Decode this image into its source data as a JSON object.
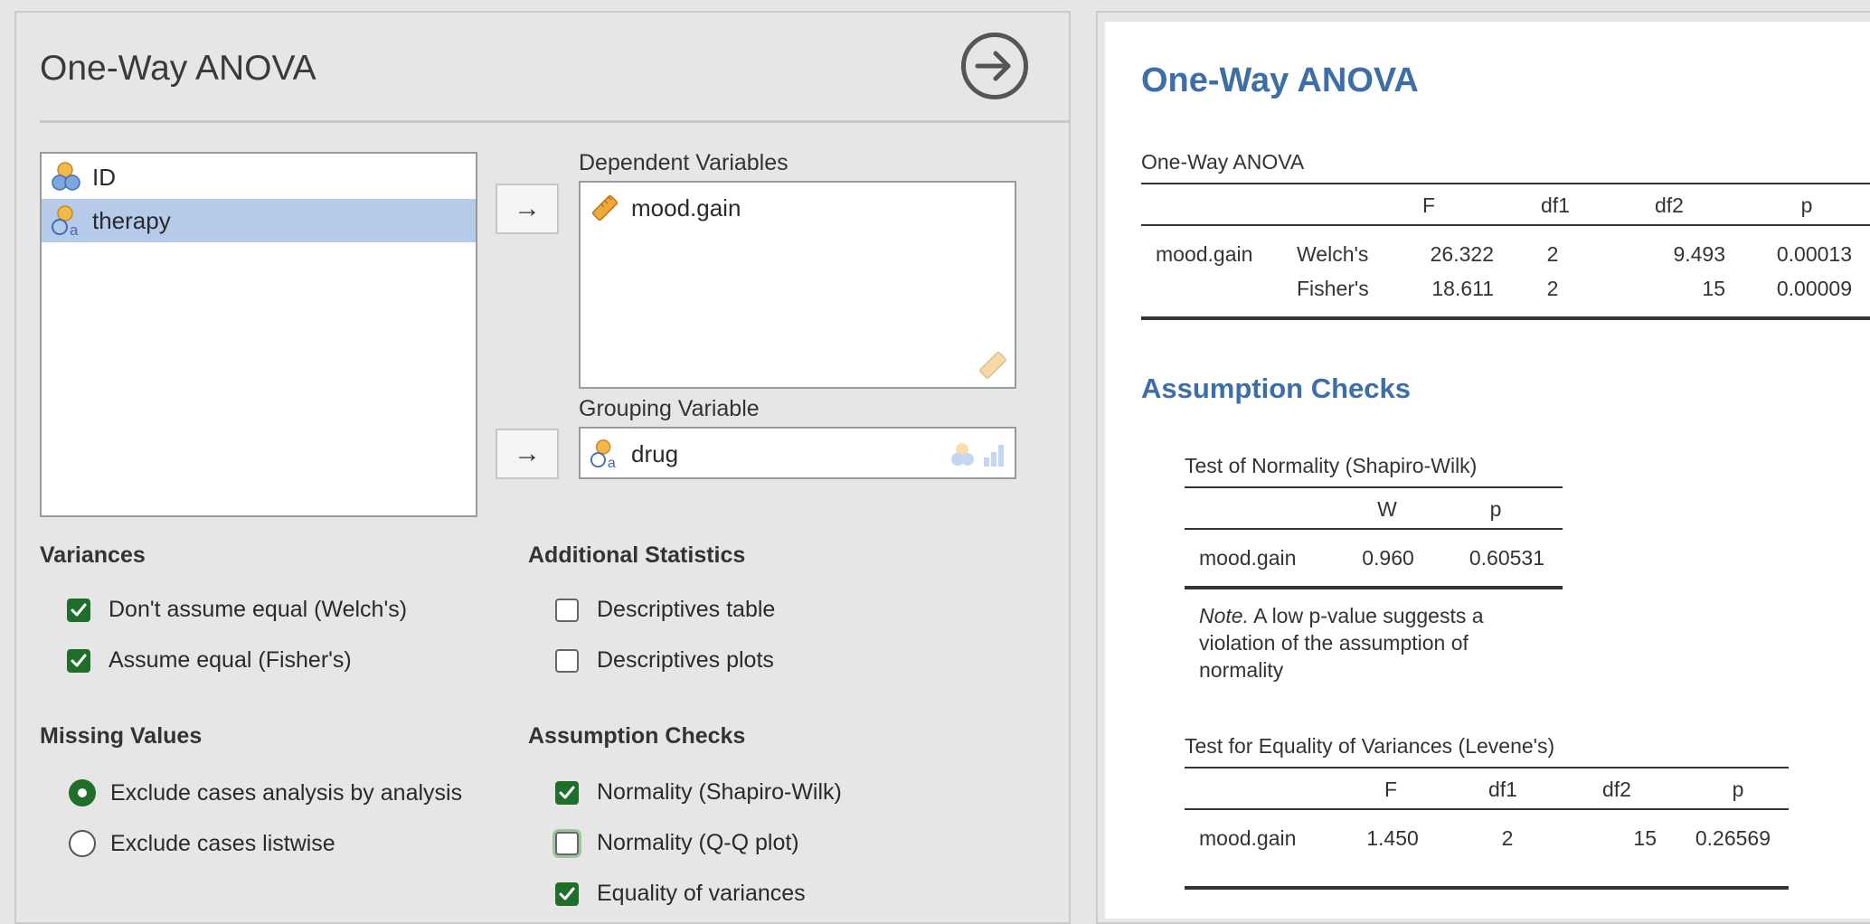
{
  "options": {
    "title": "One-Way ANOVA",
    "variables": [
      {
        "name": "ID",
        "type": "nominal-numeric",
        "selected": false
      },
      {
        "name": "therapy",
        "type": "nominal-text",
        "selected": true
      }
    ],
    "dependent_label": "Dependent Variables",
    "dependent_items": [
      "mood.gain"
    ],
    "grouping_label": "Grouping Variable",
    "grouping_item": "drug",
    "move_arrow": "→",
    "variances": {
      "heading": "Variances",
      "items": [
        {
          "label": "Don't assume equal (Welch's)",
          "checked": true
        },
        {
          "label": "Assume equal (Fisher's)",
          "checked": true
        }
      ]
    },
    "additional": {
      "heading": "Additional Statistics",
      "items": [
        {
          "label": "Descriptives table",
          "checked": false
        },
        {
          "label": "Descriptives plots",
          "checked": false
        }
      ]
    },
    "missing": {
      "heading": "Missing Values",
      "items": [
        {
          "label": "Exclude cases analysis by analysis",
          "selected": true
        },
        {
          "label": "Exclude cases listwise",
          "selected": false
        }
      ]
    },
    "assumptions": {
      "heading": "Assumption Checks",
      "items": [
        {
          "label": "Normality (Shapiro-Wilk)",
          "checked": true
        },
        {
          "label": "Normality (Q-Q plot)",
          "checked": false
        },
        {
          "label": "Equality of variances",
          "checked": true
        }
      ]
    }
  },
  "results": {
    "title": "One-Way ANOVA",
    "anova_table": {
      "title": "One-Way ANOVA",
      "headers": [
        "",
        "",
        "F",
        "df1",
        "df2",
        "p"
      ],
      "rows": [
        [
          "mood.gain",
          "Welch's",
          "26.322",
          "2",
          "9.493",
          "0.00013"
        ],
        [
          "",
          "Fisher's",
          "18.611",
          "2",
          "15",
          "0.00009"
        ]
      ]
    },
    "assumption_title": "Assumption Checks",
    "normality_table": {
      "title": "Test of Normality (Shapiro-Wilk)",
      "headers": [
        "",
        "W",
        "p"
      ],
      "rows": [
        [
          "mood.gain",
          "0.960",
          "0.60531"
        ]
      ],
      "note_label": "Note.",
      "note_text": " A low p-value suggests a violation of the assumption of normality"
    },
    "levene_table": {
      "title": "Test for Equality of Variances (Levene's)",
      "headers": [
        "",
        "F",
        "df1",
        "df2",
        "p"
      ],
      "rows": [
        [
          "mood.gain",
          "1.450",
          "2",
          "15",
          "0.26569"
        ]
      ]
    }
  },
  "colors": {
    "accent_blue": "#3e6ea8",
    "check_green": "#1f6f2a",
    "selection": "#b6cbe9"
  }
}
